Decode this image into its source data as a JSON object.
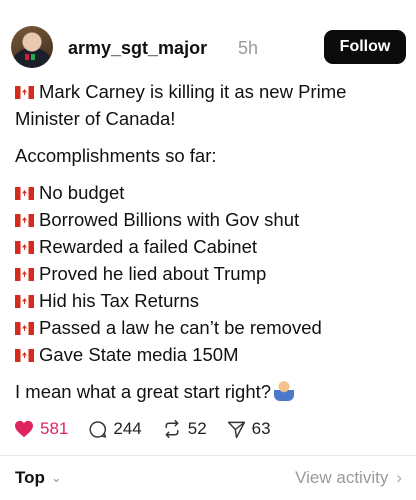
{
  "post": {
    "username": "army_sgt_major",
    "time": "5h",
    "follow_label": "Follow",
    "intro_line1": "Mark Carney is killing it as new Prime",
    "intro_line2": "Minister of Canada!",
    "accomplishments_heading": "Accomplishments so far:",
    "items": [
      "No budget",
      "Borrowed Billions with Gov shut",
      "Rewarded a failed Cabinet",
      "Proved he lied about Trump",
      "Hid his Tax Returns",
      "Passed a law he can’t be removed",
      "Gave State media 150M"
    ],
    "closing": "I mean what a great start right?",
    "flag_icon": "canada-flag-icon",
    "emoji_icon": "person-shrugging-icon"
  },
  "actions": {
    "likes": "581",
    "comments": "244",
    "reposts": "52",
    "shares": "63",
    "like_color": "#e0245e"
  },
  "footer": {
    "sort_label": "Top",
    "view_activity_label": "View activity"
  }
}
